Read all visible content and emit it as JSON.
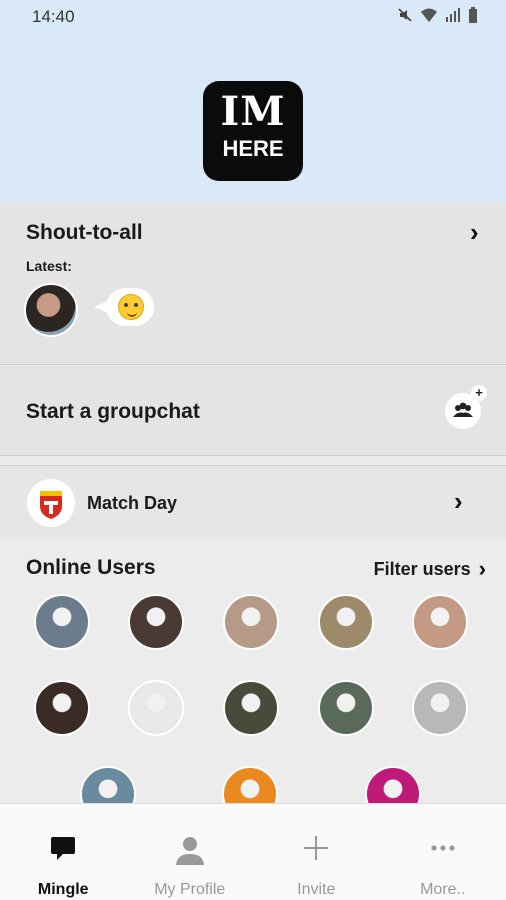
{
  "status_bar": {
    "time": "14:40"
  },
  "logo": {
    "line1": "IM",
    "line2": "HERE"
  },
  "shout": {
    "title": "Shout-to-all",
    "latest_label": "Latest:"
  },
  "groupchat": {
    "title": "Start a groupchat"
  },
  "match_day": {
    "title": "Match Day"
  },
  "online_users": {
    "title": "Online Users",
    "filter_label": "Filter users",
    "avatars": [
      {
        "color": "#6b7c8d"
      },
      {
        "color": "#4a3a33"
      },
      {
        "color": "#b59a88"
      },
      {
        "color": "#9d8a6a"
      },
      {
        "color": "#c49a85"
      },
      {
        "color": "#3b2a25"
      },
      {
        "color": "#e8e8e8"
      },
      {
        "color": "#4a4a3a"
      },
      {
        "color": "#5a6a5a"
      },
      {
        "color": "#b8b8b8"
      },
      {
        "color": "#6a8aa0"
      },
      {
        "color": "#e88a20"
      },
      {
        "color": "#c01a78"
      }
    ]
  },
  "nav": {
    "mingle": "Mingle",
    "profile": "My Profile",
    "invite": "Invite",
    "more": "More.."
  }
}
